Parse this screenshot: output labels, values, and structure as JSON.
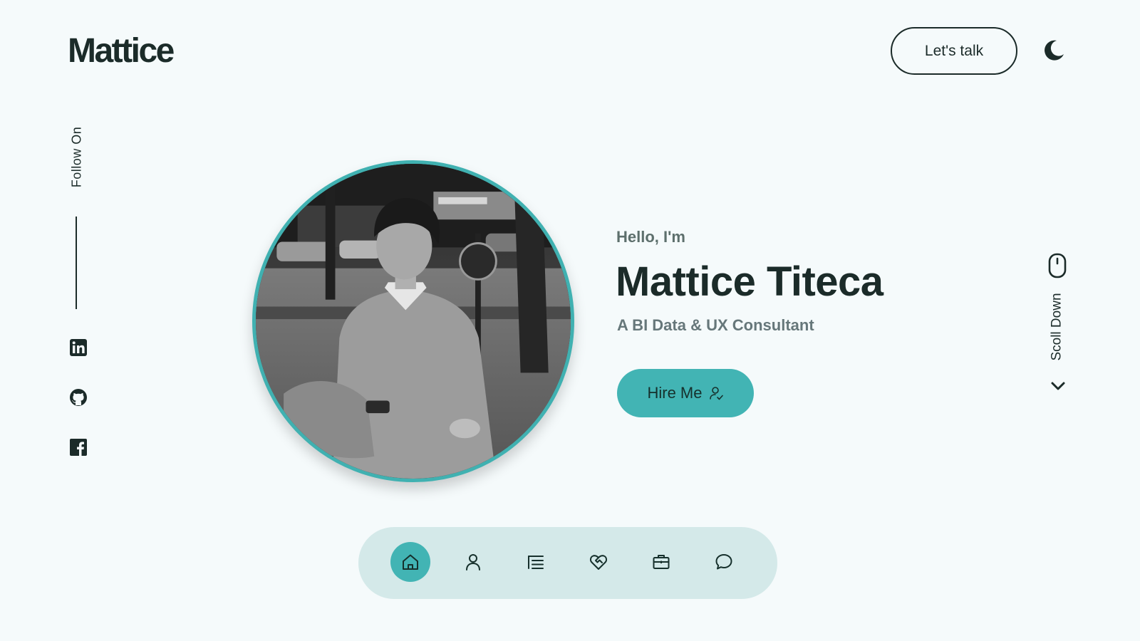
{
  "header": {
    "logo": "Mattice",
    "talk_button": "Let's talk",
    "theme_icon": "moon-icon"
  },
  "social": {
    "follow_label": "Follow On",
    "links": [
      {
        "name": "linkedin",
        "icon": "linkedin-icon"
      },
      {
        "name": "github",
        "icon": "github-icon"
      },
      {
        "name": "facebook",
        "icon": "facebook-icon"
      }
    ]
  },
  "intro": {
    "greeting": "Hello, I'm",
    "name": "Mattice Titeca",
    "role": "A BI Data & UX Consultant",
    "hire_button": "Hire Me",
    "hire_icon": "user-check-icon"
  },
  "scroll": {
    "label": "Scoll Down",
    "icons": [
      "mouse-icon",
      "chevron-down-icon"
    ]
  },
  "nav": {
    "items": [
      {
        "name": "home",
        "icon": "home-icon",
        "active": true
      },
      {
        "name": "about",
        "icon": "user-icon",
        "active": false
      },
      {
        "name": "skills",
        "icon": "list-icon",
        "active": false
      },
      {
        "name": "services",
        "icon": "heart-handshake-icon",
        "active": false
      },
      {
        "name": "portfolio",
        "icon": "briefcase-icon",
        "active": false
      },
      {
        "name": "contact",
        "icon": "message-icon",
        "active": false
      }
    ]
  },
  "colors": {
    "background": "#f5fafb",
    "accent": "#42b4b4",
    "text_dark": "#1b2b29",
    "nav_background": "#d4e9e9"
  }
}
